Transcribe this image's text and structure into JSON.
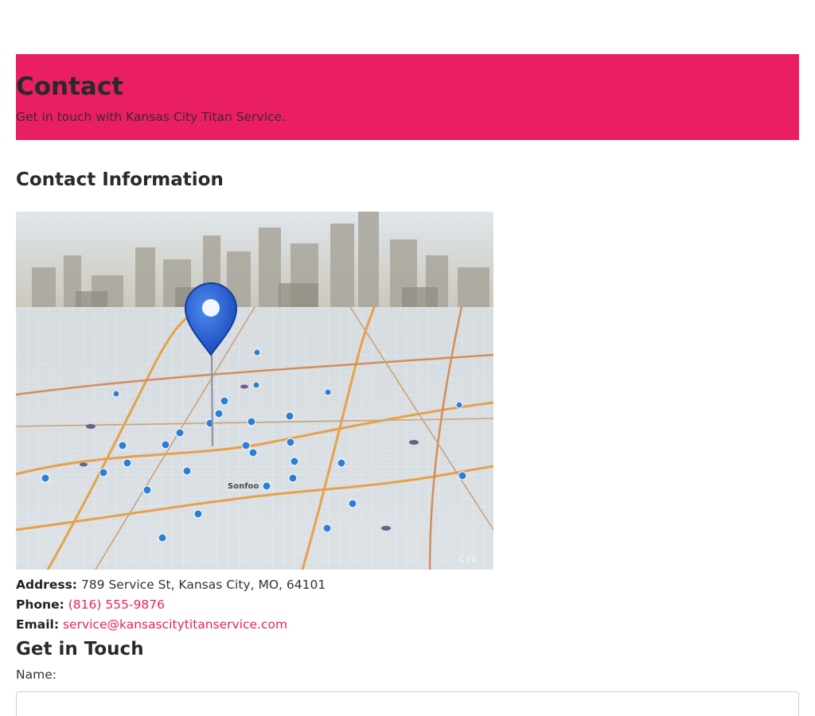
{
  "hero": {
    "title": "Contact",
    "subtitle": "Get in touch with Kansas City Titan Service.",
    "background_color": "#ea1f62"
  },
  "contact_info": {
    "heading": "Contact Information",
    "map_image": {
      "map_label": "Sonfoo",
      "watermark": "C Ed"
    },
    "address_label": "Address:",
    "address_value": "789 Service St, Kansas City, MO, 64101",
    "phone_label": "Phone:",
    "phone_value": "(816) 555-9876",
    "email_label": "Email:",
    "email_value": "service@kansascitytitanservice.com",
    "link_color": "#ea1f62"
  },
  "form": {
    "heading": "Get in Touch",
    "name_label": "Name:",
    "name_value": "",
    "name_placeholder": ""
  }
}
